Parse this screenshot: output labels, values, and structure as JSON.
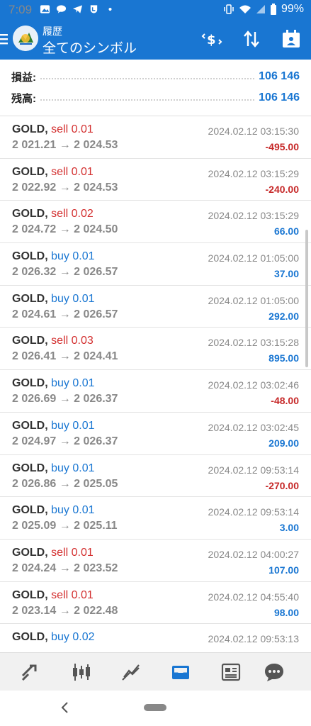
{
  "status_bar": {
    "time": "7:09",
    "battery": "99%"
  },
  "app_bar": {
    "subtitle": "履歴",
    "title": "全てのシンボル"
  },
  "summary": {
    "profit_label": "損益:",
    "profit_value": "106 146",
    "balance_label": "残高:",
    "balance_value": "106 146"
  },
  "trades": [
    {
      "symbol": "GOLD,",
      "side": "sell",
      "volume": "0.01",
      "prices": "2 021.21 → 2 024.53",
      "time": "2024.02.12 03:15:30",
      "profit": "-495.00"
    },
    {
      "symbol": "GOLD,",
      "side": "sell",
      "volume": "0.01",
      "prices": "2 022.92 → 2 024.53",
      "time": "2024.02.12 03:15:29",
      "profit": "-240.00"
    },
    {
      "symbol": "GOLD,",
      "side": "sell",
      "volume": "0.02",
      "prices": "2 024.72 → 2 024.50",
      "time": "2024.02.12 03:15:29",
      "profit": "66.00"
    },
    {
      "symbol": "GOLD,",
      "side": "buy",
      "volume": "0.01",
      "prices": "2 026.32 → 2 026.57",
      "time": "2024.02.12 01:05:00",
      "profit": "37.00"
    },
    {
      "symbol": "GOLD,",
      "side": "buy",
      "volume": "0.01",
      "prices": "2 024.61 → 2 026.57",
      "time": "2024.02.12 01:05:00",
      "profit": "292.00"
    },
    {
      "symbol": "GOLD,",
      "side": "sell",
      "volume": "0.03",
      "prices": "2 026.41 → 2 024.41",
      "time": "2024.02.12 03:15:28",
      "profit": "895.00"
    },
    {
      "symbol": "GOLD,",
      "side": "buy",
      "volume": "0.01",
      "prices": "2 026.69 → 2 026.37",
      "time": "2024.02.12 03:02:46",
      "profit": "-48.00"
    },
    {
      "symbol": "GOLD,",
      "side": "buy",
      "volume": "0.01",
      "prices": "2 024.97 → 2 026.37",
      "time": "2024.02.12 03:02:45",
      "profit": "209.00"
    },
    {
      "symbol": "GOLD,",
      "side": "buy",
      "volume": "0.01",
      "prices": "2 026.86 → 2 025.05",
      "time": "2024.02.12 09:53:14",
      "profit": "-270.00"
    },
    {
      "symbol": "GOLD,",
      "side": "buy",
      "volume": "0.01",
      "prices": "2 025.09 → 2 025.11",
      "time": "2024.02.12 09:53:14",
      "profit": "3.00"
    },
    {
      "symbol": "GOLD,",
      "side": "sell",
      "volume": "0.01",
      "prices": "2 024.24 → 2 023.52",
      "time": "2024.02.12 04:00:27",
      "profit": "107.00"
    },
    {
      "symbol": "GOLD,",
      "side": "sell",
      "volume": "0.01",
      "prices": "2 023.14 → 2 022.48",
      "time": "2024.02.12 04:55:40",
      "profit": "98.00"
    },
    {
      "symbol": "GOLD,",
      "side": "buy",
      "volume": "0.02",
      "prices": "",
      "time": "2024.02.12 09:53:13",
      "profit": ""
    }
  ],
  "colors": {
    "primary": "#1976d2",
    "sell": "#d32f2f",
    "negative": "#c62828",
    "positive": "#1976d2"
  },
  "bottom_nav": [
    "quotes-icon",
    "chart-icon",
    "trade-icon",
    "history-icon",
    "news-icon",
    "chat-icon"
  ]
}
